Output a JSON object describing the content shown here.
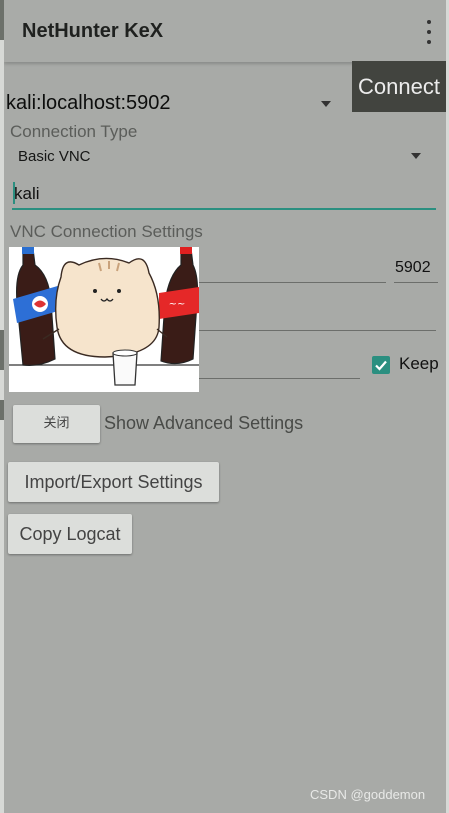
{
  "app_bar": {
    "title": "NetHunter KeX",
    "menu_icon": "more-vert-icon"
  },
  "connect_button": {
    "label": "Connect"
  },
  "session": {
    "selected": "kali:localhost:5902"
  },
  "connection_type": {
    "label": "Connection Type",
    "selected": "Basic VNC"
  },
  "username": {
    "value": "kali"
  },
  "vnc_settings": {
    "section_label": "VNC Connection Settings",
    "port": "5902",
    "keep_password_label": "Keep",
    "keep_password_checked": true
  },
  "advanced": {
    "toggle_label": "关闭",
    "label": "Show Advanced Settings"
  },
  "import_export_button": {
    "label": "Import/Export Settings"
  },
  "copy_logcat_button": {
    "label": "Copy Logcat"
  },
  "watermark": "CSDN @goddemon",
  "colors": {
    "accent": "#2b8f80",
    "background": "#a8aaa7",
    "connect_button": "#42443f"
  }
}
